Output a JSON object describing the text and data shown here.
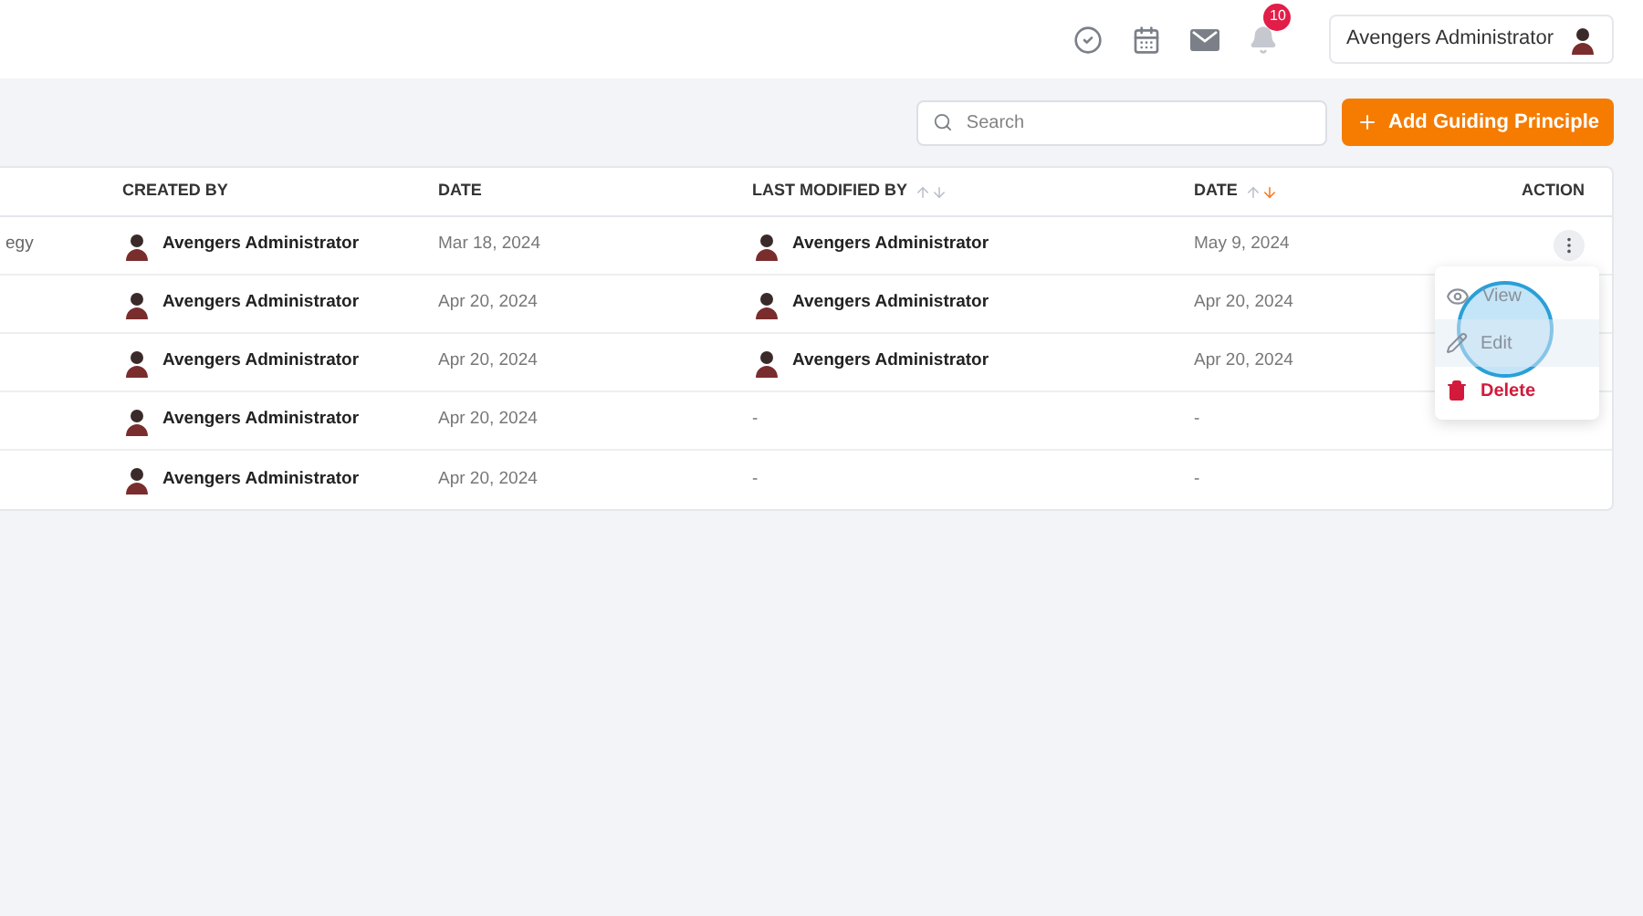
{
  "header": {
    "notification_count": "10",
    "user_name": "Avengers Administrator"
  },
  "toolbar": {
    "search": {
      "placeholder": "Search"
    },
    "add_button": "Add Guiding Principle"
  },
  "table": {
    "columns": [
      {},
      {
        "label": "CREATED BY"
      },
      {
        "label": "DATE"
      },
      {
        "label": "LAST MODIFIED BY",
        "sortable": true,
        "sorted_descending": false
      },
      {
        "label": "DATE",
        "sortable": true,
        "sorted_descending": true
      },
      {
        "label": "ACTION"
      }
    ],
    "rows": [
      {
        "column_1": "egy",
        "created_by": "Avengers Administrator",
        "date": "Mar 18, 2024",
        "last_modified_by": "Avengers Administrator",
        "modified_date": "May 9, 2024",
        "menu_open": true
      },
      {
        "created_by": "Avengers Administrator",
        "date": "Apr 20, 2024",
        "last_modified_by": "Avengers Administrator",
        "modified_date": "Apr 20, 2024",
        "menu_open": false
      },
      {
        "created_by": "Avengers Administrator",
        "date": "Apr 20, 2024",
        "last_modified_by": "Avengers Administrator",
        "modified_date": "Apr 20, 2024",
        "menu_open": false
      },
      {
        "created_by": "Avengers Administrator",
        "date": "Apr 20, 2024",
        "last_modified_by": "-",
        "modified_date": "-",
        "menu_open": false
      },
      {
        "created_by": "Avengers Administrator",
        "date": "Apr 20, 2024",
        "last_modified_by": "-",
        "modified_date": "-",
        "menu_open": false
      }
    ]
  },
  "action_menu": {
    "items": [
      {
        "kind": "view",
        "label": "View",
        "highlighted": false
      },
      {
        "kind": "edit",
        "label": "Edit",
        "highlighted": true
      },
      {
        "kind": "delete",
        "label": "Delete",
        "highlighted": false
      }
    ]
  }
}
